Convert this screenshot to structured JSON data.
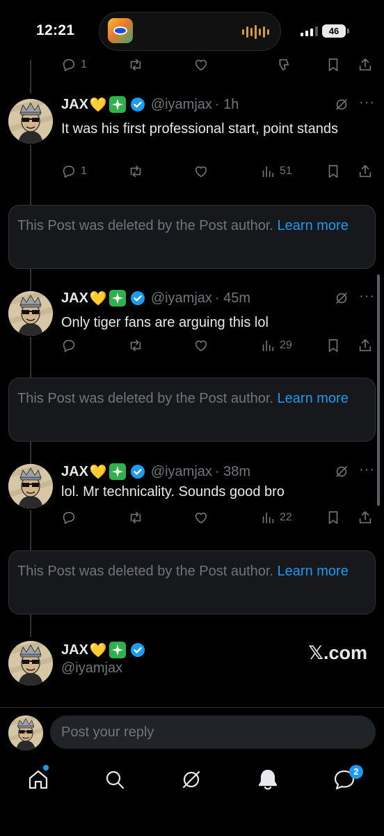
{
  "status_bar": {
    "time": "12:21",
    "battery": "46"
  },
  "top_actions": {
    "reply_count": "1"
  },
  "tweets": [
    {
      "name": "JAX",
      "heart": "💛",
      "handle": "@iyamjax",
      "time": "· 1h",
      "text": "It was his first professional start, point stands",
      "reply_count": "1",
      "views": "51"
    },
    {
      "name": "JAX",
      "heart": "💛",
      "handle": "@iyamjax",
      "time": "· 45m",
      "text": "Only tiger fans are arguing this lol",
      "reply_count": "",
      "views": "29"
    },
    {
      "name": "JAX",
      "heart": "💛",
      "handle": "@iyamjax",
      "time": "· 38m",
      "text": "lol. Mr technicality. Sounds good bro",
      "reply_count": "",
      "views": "22"
    }
  ],
  "deleted_notice": {
    "text": "This Post was deleted by the Post author. ",
    "link": "Learn more"
  },
  "footer_post": {
    "name": "JAX",
    "heart": "💛",
    "handle": "@iyamjax",
    "brand": "𝕏.com"
  },
  "reply_box": {
    "placeholder": "Post your reply"
  },
  "nav": {
    "messages_badge": "2"
  },
  "icons": [
    "reply-icon",
    "repost-icon",
    "like-icon",
    "views-icon",
    "bookmark-icon",
    "share-icon",
    "grok-icon",
    "more-icon",
    "home-icon",
    "search-icon",
    "notifications-icon",
    "messages-icon"
  ],
  "colors": {
    "background": "#000000",
    "accent": "#1d9bf0",
    "muted": "#71767b",
    "text": "#e7e9ea",
    "verified": "#1d9bf0",
    "sparkle_box": "#2fb24c"
  }
}
